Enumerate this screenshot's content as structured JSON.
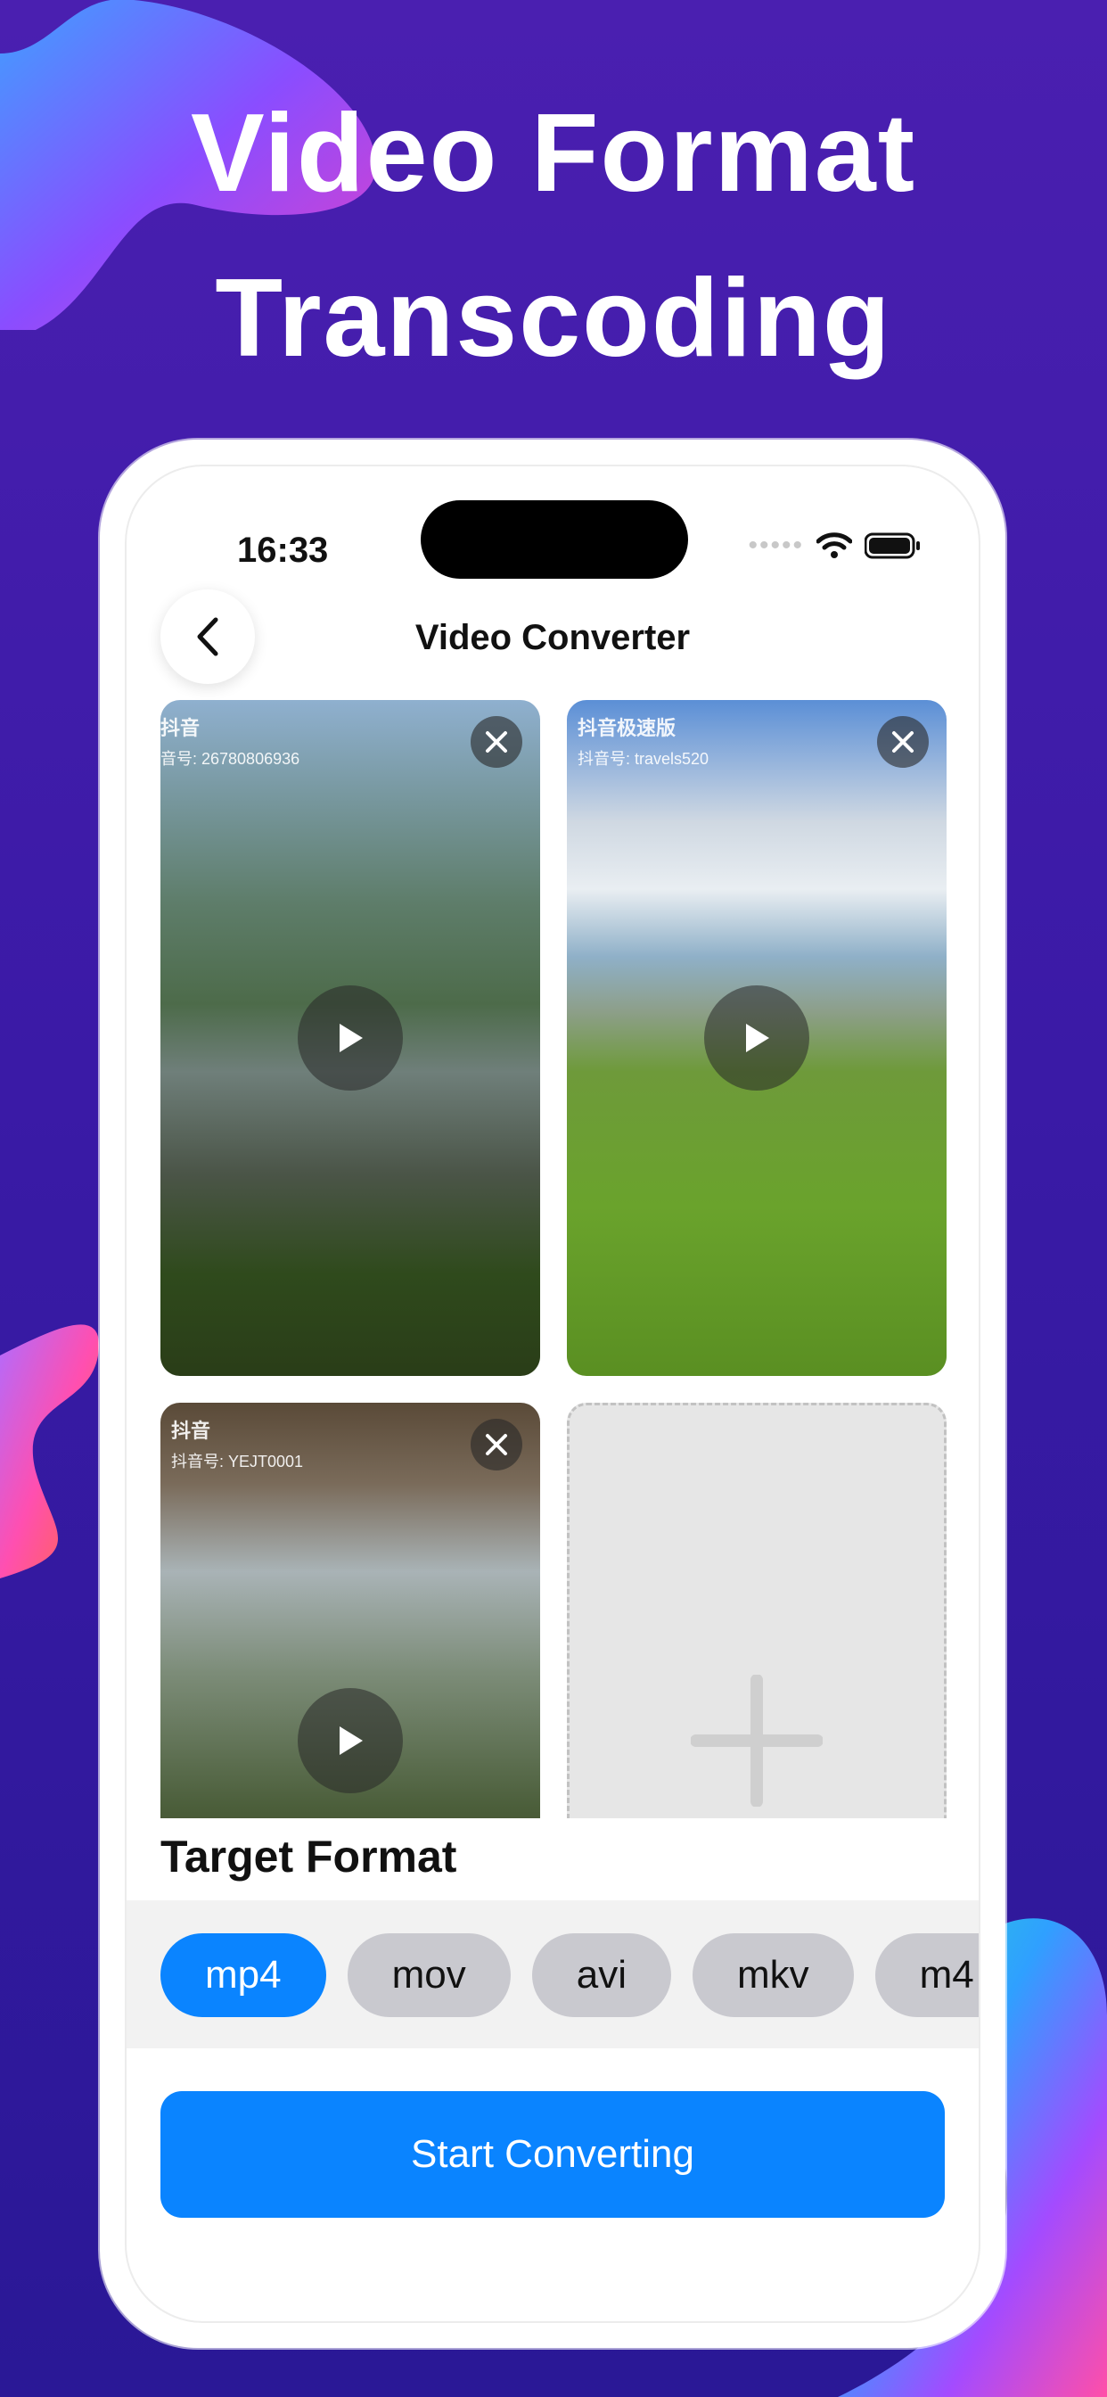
{
  "headline": {
    "line1": "Video Format",
    "line2": "Transcoding"
  },
  "status_bar": {
    "time": "16:33"
  },
  "nav": {
    "title": "Video Converter",
    "back_icon": "chevron-left-icon"
  },
  "videos": [
    {
      "watermark": "抖音",
      "watermark_sub": "音号: 26780806936",
      "icon": "play-icon"
    },
    {
      "watermark": "抖音极速版",
      "watermark_sub": "抖音号: travels520",
      "icon": "play-icon"
    },
    {
      "watermark": "抖音",
      "watermark_sub": "抖音号: YEJT0001",
      "icon": "play-icon"
    }
  ],
  "add_tile": {
    "icon": "plus-icon"
  },
  "target_format": {
    "title": "Target Format",
    "options": [
      "mp4",
      "mov",
      "avi",
      "mkv",
      "m4"
    ],
    "selected": "mp4"
  },
  "cta": {
    "label": "Start Converting"
  },
  "colors": {
    "accent": "#0a84ff",
    "background": "#3a1aa6",
    "chip_inactive": "#c9c9cf"
  }
}
